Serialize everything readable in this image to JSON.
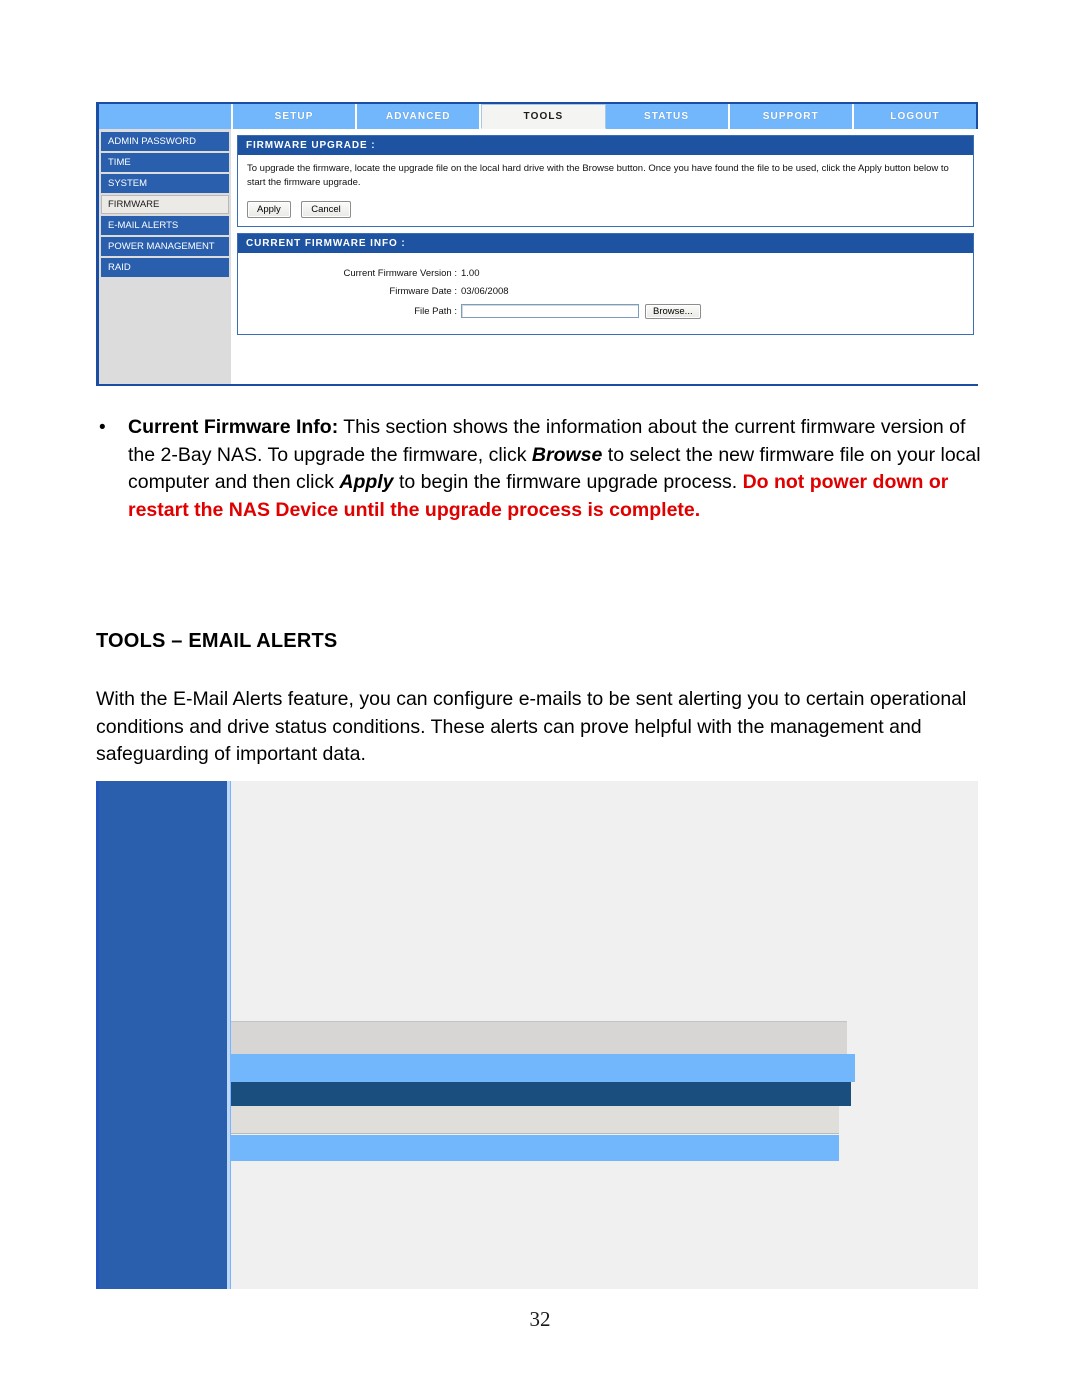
{
  "document": {
    "page_number": "32"
  },
  "figure_firmware": {
    "nav_tabs": [
      {
        "label": "SETUP",
        "active": false
      },
      {
        "label": "ADVANCED",
        "active": false
      },
      {
        "label": "TOOLS",
        "active": true
      },
      {
        "label": "STATUS",
        "active": false
      },
      {
        "label": "SUPPORT",
        "active": false
      },
      {
        "label": "LOGOUT",
        "active": false
      }
    ],
    "sidebar": {
      "items": [
        {
          "label": "ADMIN PASSWORD",
          "active": false
        },
        {
          "label": "TIME",
          "active": false
        },
        {
          "label": "SYSTEM",
          "active": false
        },
        {
          "label": "FIRMWARE",
          "active": true
        },
        {
          "label": "E-MAIL ALERTS",
          "active": false
        },
        {
          "label": "POWER MANAGEMENT",
          "active": false
        },
        {
          "label": "RAID",
          "active": false
        }
      ]
    },
    "panel_firmware_upgrade": {
      "title": "FIRMWARE UPGRADE :",
      "description": "To upgrade the firmware, locate the upgrade file on the local hard drive with the Browse button. Once you have found the file to be used, click the Apply button below to start the firmware upgrade.",
      "apply_label": "Apply",
      "cancel_label": "Cancel"
    },
    "panel_current_firmware_info": {
      "title": "CURRENT FIRMWARE INFO :",
      "rows": [
        {
          "label": "Current Firmware Version :",
          "value": "1.00"
        },
        {
          "label": "Firmware Date :",
          "value": "03/06/2008"
        }
      ],
      "file_path_label": "File Path :",
      "file_path_value": "",
      "file_path_placeholder": "",
      "browse_label": "Browse..."
    }
  },
  "body": {
    "bullet_firmware_info": {
      "bullet_marker": "•",
      "lead_label": "Current Firmware Info:",
      "text_1": " This section shows the information about the current firmware version of the 2-Bay NAS. To upgrade the firmware, click ",
      "emph_browse": "Browse",
      "text_2": " to select the new firmware file on your local computer and then click ",
      "emph_apply": "Apply",
      "text_3": " to begin the firmware upgrade process. ",
      "warning": "Do not power down or restart the NAS Device until the upgrade process is complete."
    },
    "section_heading": "TOOLS – EMAIL ALERTS",
    "section_paragraph": "With the E-Mail Alerts feature, you can configure e-mails to be sent alerting you to certain operational conditions and drive status conditions. These alerts can prove helpful with the management and safeguarding of important data."
  },
  "figure_email_alerts": {
    "description": "E-Mail Alerts configuration screen (content area rendered blank in this scan)",
    "bands": [
      {
        "name": "row-grey-1",
        "color": "#d7d6d4"
      },
      {
        "name": "row-blue-1",
        "color": "#72b6fb"
      },
      {
        "name": "row-navy",
        "color": "#1a4e7e"
      },
      {
        "name": "row-grey-2",
        "color": "#e0dedb"
      },
      {
        "name": "row-blue-2",
        "color": "#72b6fb"
      }
    ],
    "sidebar_color": "#2a5fae",
    "content_color": "#f0f0f0"
  }
}
